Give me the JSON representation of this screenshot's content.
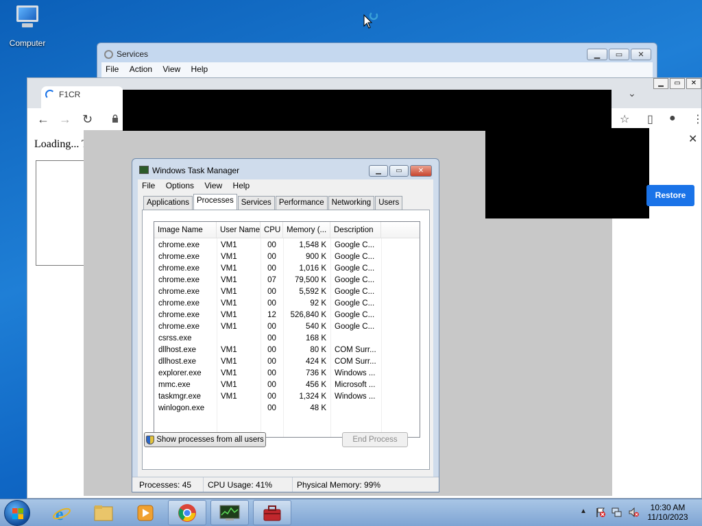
{
  "desktop": {
    "computer_label": "Computer"
  },
  "services": {
    "title": "Services",
    "menu": [
      "File",
      "Action",
      "View",
      "Help"
    ]
  },
  "chrome": {
    "tab_title": "F1CR",
    "loading_text": "Loading... This will",
    "restore_label": "Restore"
  },
  "taskmgr": {
    "title": "Windows Task Manager",
    "menu": [
      "File",
      "Options",
      "View",
      "Help"
    ],
    "tabs": [
      "Applications",
      "Processes",
      "Services",
      "Performance",
      "Networking",
      "Users"
    ],
    "active_tab": "Processes",
    "columns": [
      "Image Name",
      "User Name",
      "CPU",
      "Memory (...",
      "Description"
    ],
    "rows": [
      [
        "chrome.exe",
        "VM1",
        "00",
        "1,548 K",
        "Google C..."
      ],
      [
        "chrome.exe",
        "VM1",
        "00",
        "900 K",
        "Google C..."
      ],
      [
        "chrome.exe",
        "VM1",
        "00",
        "1,016 K",
        "Google C..."
      ],
      [
        "chrome.exe",
        "VM1",
        "07",
        "79,500 K",
        "Google C..."
      ],
      [
        "chrome.exe",
        "VM1",
        "00",
        "5,592 K",
        "Google C..."
      ],
      [
        "chrome.exe",
        "VM1",
        "00",
        "92 K",
        "Google C..."
      ],
      [
        "chrome.exe",
        "VM1",
        "12",
        "526,840 K",
        "Google C..."
      ],
      [
        "chrome.exe",
        "VM1",
        "00",
        "540 K",
        "Google C..."
      ],
      [
        "csrss.exe",
        "",
        "00",
        "168 K",
        ""
      ],
      [
        "dllhost.exe",
        "VM1",
        "00",
        "80 K",
        "COM Surr..."
      ],
      [
        "dllhost.exe",
        "VM1",
        "00",
        "424 K",
        "COM Surr..."
      ],
      [
        "explorer.exe",
        "VM1",
        "00",
        "736 K",
        "Windows ..."
      ],
      [
        "mmc.exe",
        "VM1",
        "00",
        "456 K",
        "Microsoft ..."
      ],
      [
        "taskmgr.exe",
        "VM1",
        "00",
        "1,324 K",
        "Windows ..."
      ],
      [
        "winlogon.exe",
        "",
        "00",
        "48 K",
        ""
      ]
    ],
    "show_all_label": "Show processes from all users",
    "end_process_label": "End Process",
    "status": {
      "processes": "Processes: 45",
      "cpu": "CPU Usage: 41%",
      "memory": "Physical Memory: 99%"
    }
  },
  "taskbar": {
    "time": "10:30 AM",
    "date": "11/10/2023"
  }
}
